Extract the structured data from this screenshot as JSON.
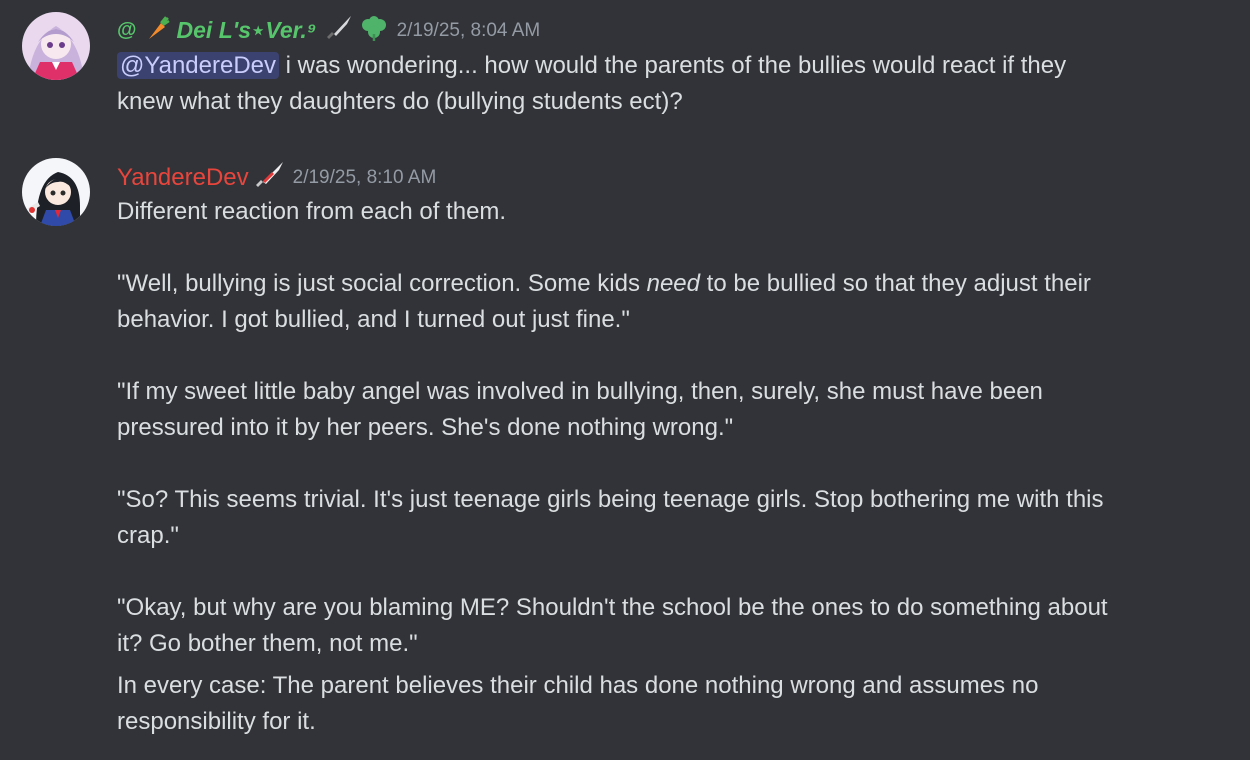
{
  "messages": [
    {
      "author": {
        "prefix": "@",
        "name": "Dei L's⋆Ver.⁹",
        "color": "#57c56b",
        "avatar_icon": "anime-girl-avatar-pink"
      },
      "timestamp": "2/19/25, 8:04 AM",
      "mention": "@YandereDev",
      "lines": [
        "i was wondering... how would the parents of the bullies would react if they",
        "knew what they daughters do (bullying students ect)?"
      ]
    },
    {
      "author": {
        "name": "YandereDev",
        "color": "#e8453c",
        "avatar_icon": "anime-schoolgirl-avatar"
      },
      "timestamp": "2/19/25, 8:10 AM",
      "lines": {
        "l1": "Different reaction from each of them.",
        "p1a_before": "\"Well, bullying is just social correction. Some kids ",
        "p1a_em": "need",
        "p1a_after": " to be bullied so that they adjust their",
        "p1b": "behavior. I got bullied, and I turned out just fine.\"",
        "p2a": "\"If my sweet little baby angel was involved in bullying, then, surely, she must have been",
        "p2b": "pressured into it by her peers. She's done nothing wrong.\"",
        "p3a": "\"So? This seems trivial. It's just teenage girls being teenage girls. Stop bothering me with this",
        "p3b": "crap.\"",
        "p4a": "\"Okay, but why are you blaming ME? Shouldn't the school be the ones to do something about",
        "p4b": "it? Go bother them, not me.\"",
        "p5a": "In every case: The parent believes their child has done nothing wrong and assumes no",
        "p5b": "responsibility for it."
      }
    }
  ]
}
